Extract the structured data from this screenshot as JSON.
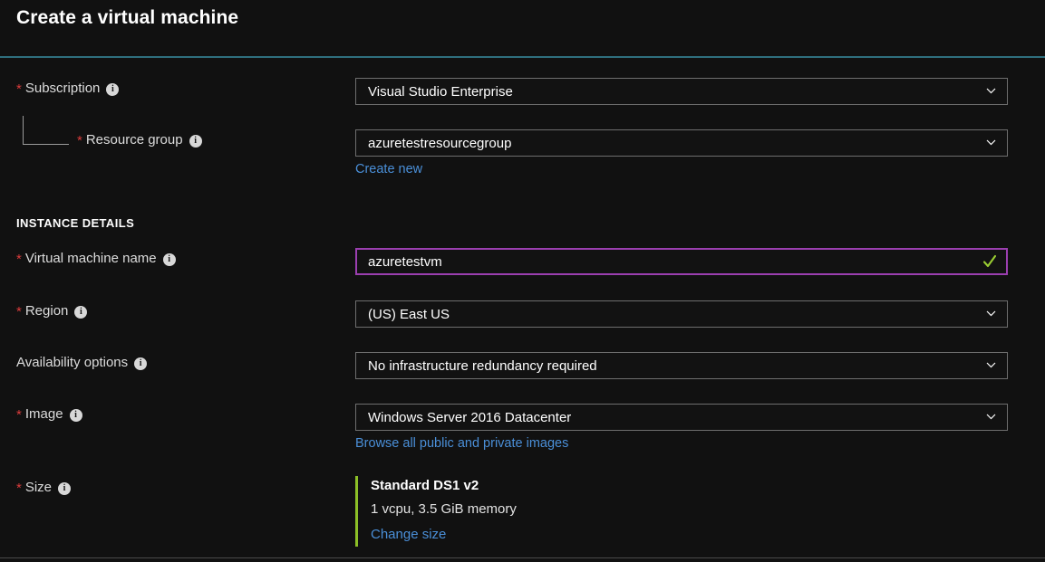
{
  "page": {
    "title": "Create a virtual machine"
  },
  "sections": {
    "instance_details_heading": "INSTANCE DETAILS"
  },
  "fields": {
    "subscription": {
      "label": "Subscription",
      "required": true,
      "has_info": true,
      "value": "Visual Studio Enterprise",
      "control": "dropdown"
    },
    "resource_group": {
      "label": "Resource group",
      "required": true,
      "has_info": true,
      "value": "azuretestresourcegroup",
      "control": "dropdown",
      "sublink": "Create new"
    },
    "vm_name": {
      "label": "Virtual machine name",
      "required": true,
      "has_info": true,
      "value": "azuretestvm",
      "control": "textbox",
      "state": "focused-valid"
    },
    "region": {
      "label": "Region",
      "required": true,
      "has_info": true,
      "value": "(US) East US",
      "control": "dropdown"
    },
    "availability_options": {
      "label": "Availability options",
      "required": false,
      "has_info": true,
      "value": "No infrastructure redundancy required",
      "control": "dropdown"
    },
    "image": {
      "label": "Image",
      "required": true,
      "has_info": true,
      "value": "Windows Server 2016 Datacenter",
      "control": "dropdown",
      "sublink": "Browse all public and private images"
    },
    "size": {
      "label": "Size",
      "required": true,
      "has_info": true,
      "summary_title": "Standard DS1 v2",
      "summary_specs": "1 vcpu, 3.5 GiB memory",
      "change_link": "Change size"
    }
  },
  "icons": {
    "info": "info-icon",
    "chevron_down": "chevron-down-icon",
    "check": "check-icon"
  },
  "colors": {
    "background": "#111111",
    "accent_rule": "#2f6f7e",
    "link": "#4a8fd8",
    "required_star": "#d93c3c",
    "focus_border": "#9b3fb0",
    "valid_check": "#9acd32",
    "size_accent": "#8cbf26",
    "field_border": "#6e6e6e"
  }
}
